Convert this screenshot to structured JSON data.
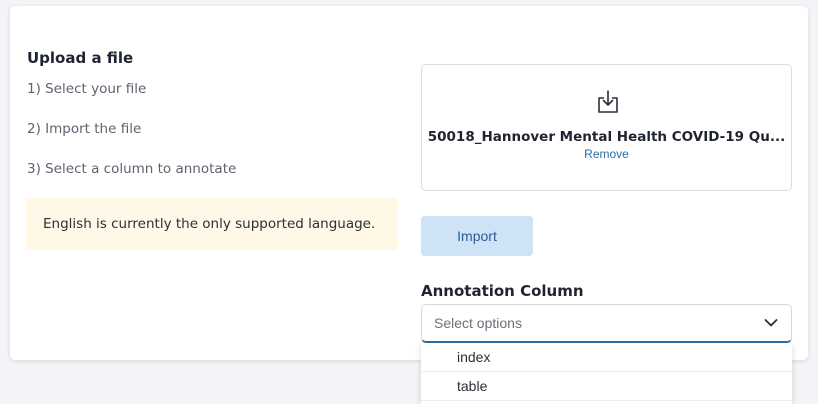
{
  "upload": {
    "title": "Upload a file",
    "steps": [
      "1) Select your file",
      "2) Import the file",
      "3) Select a column to annotate"
    ],
    "notice": "English is currently the only supported language."
  },
  "dropzone": {
    "icon": "download-tray-icon",
    "file_name": "50018_Hannover Mental Health COVID-19 Qu...",
    "remove_label": "Remove"
  },
  "import_button": {
    "label": "Import"
  },
  "annotation": {
    "label": "Annotation Column",
    "placeholder": "Select options",
    "options": [
      "index",
      "table"
    ]
  },
  "colors": {
    "accent": "#2a6fa8",
    "import_bg": "#cfe3f7",
    "notice_bg": "#fff8e6"
  }
}
